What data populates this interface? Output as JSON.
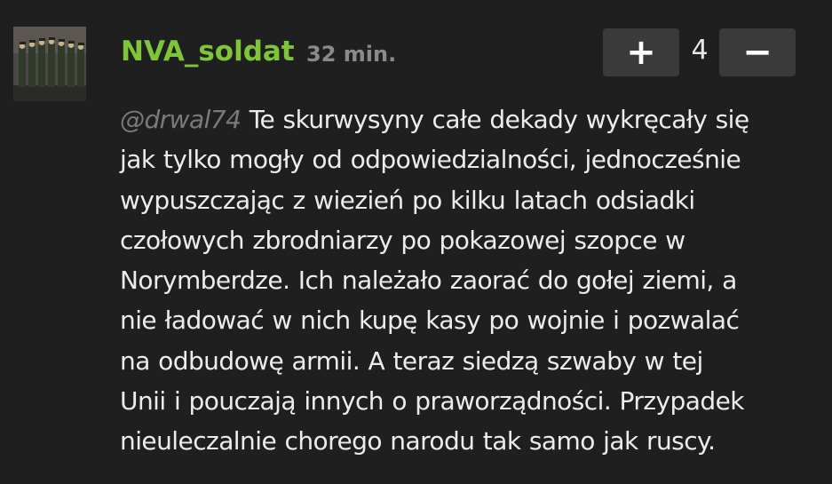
{
  "comment": {
    "author": "NVA_soldat",
    "timestamp": "32 min.",
    "vote_plus": "+",
    "vote_count": "4",
    "vote_minus": "−",
    "mention": "@drwal74",
    "lines": [
      "Te skurwysyny całe dekady wykręcały się",
      "jak tylko mogły od odpowiedzialności, jednocześnie",
      "wypuszczając z wiezień po kilku latach odsiadki",
      "czołowych zbrodniarzy po pokazowej szopce w",
      "Norymberdze. Ich należało zaorać do gołej ziemi, a",
      "nie ładować w nich kupę kasy po wojnie i pozwalać",
      "na odbudowę armii. A teraz siedzą szwaby w tej",
      "Unii i pouczają innych o praworządności. Przypadek",
      "nieuleczalnie chorego narodu tak samo jak ruscy."
    ]
  },
  "colors": {
    "background": "#1f1f1f",
    "author": "#7ec53a",
    "timestamp": "#8a8a8a",
    "button": "#3a3a3a",
    "text": "#ececec",
    "mention": "#7a7a7a"
  },
  "icons": {
    "avatar": "soldiers-parade-avatar"
  }
}
